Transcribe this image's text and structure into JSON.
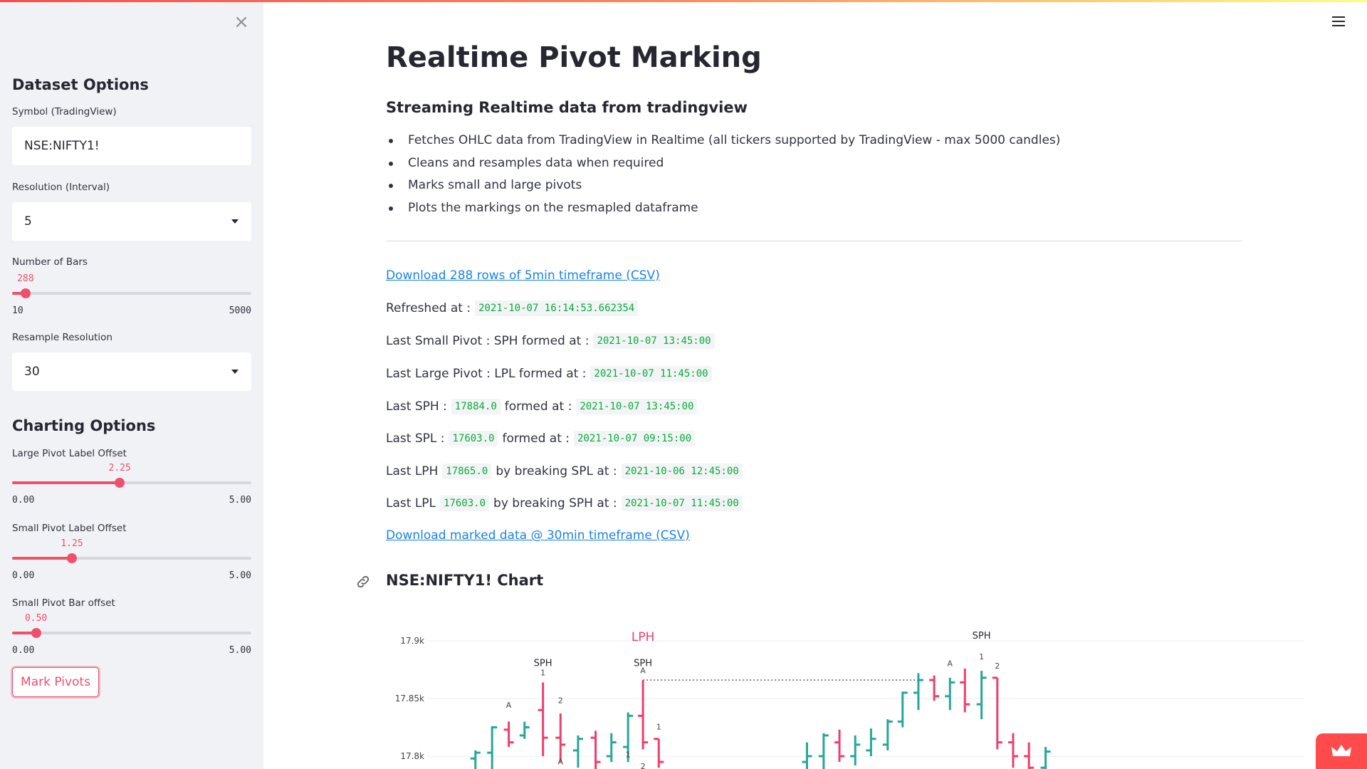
{
  "sidebar": {
    "dataset_heading": "Dataset Options",
    "symbol_label": "Symbol (TradingView)",
    "symbol_value": "NSE:NIFTY1!",
    "resolution_label": "Resolution (Interval)",
    "resolution_value": "5",
    "bars_label": "Number of Bars",
    "bars": {
      "value": "288",
      "min": "10",
      "max": "5000",
      "fraction": 0.056
    },
    "resample_label": "Resample Resolution",
    "resample_value": "30",
    "charting_heading": "Charting Options",
    "large_offset_label": "Large Pivot Label Offset",
    "large_offset": {
      "value": "2.25",
      "min": "0.00",
      "max": "5.00",
      "fraction": 0.45
    },
    "small_offset_label": "Small Pivot Label Offset",
    "small_offset": {
      "value": "1.25",
      "min": "0.00",
      "max": "5.00",
      "fraction": 0.25
    },
    "bar_offset_label": "Small Pivot Bar offset",
    "bar_offset": {
      "value": "0.50",
      "min": "0.00",
      "max": "5.00",
      "fraction": 0.1
    },
    "mark_button": "Mark Pivots"
  },
  "main": {
    "title": "Realtime Pivot Marking",
    "subtitle": "Streaming Realtime data from tradingview",
    "bullets": [
      "Fetches OHLC data from TradingView in Realtime (all tickers supported by TradingView - max 5000 candles)",
      "Cleans and resamples data when required",
      "Marks small and large pivots",
      "Plots the markings on the resmapled dataframe"
    ],
    "download_csv": "Download 288 rows of 5min timeframe (CSV)",
    "refreshed_label": "Refreshed at :",
    "refreshed_value": "2021-10-07 16:14:53.662354",
    "last_small_label": "Last Small Pivot : SPH formed at :",
    "last_small_value": "2021-10-07 13:45:00",
    "last_large_label": "Last Large Pivot : LPL formed at :",
    "last_large_value": "2021-10-07 11:45:00",
    "sph_label": "Last SPH :",
    "sph_value": "17884.0",
    "sph_mid": "formed at :",
    "sph_time": "2021-10-07 13:45:00",
    "spl_label": "Last SPL :",
    "spl_value": "17603.0",
    "spl_mid": "formed at :",
    "spl_time": "2021-10-07 09:15:00",
    "lph_label": "Last LPH",
    "lph_value": "17865.0",
    "lph_mid": "by breaking SPL at :",
    "lph_time": "2021-10-06 12:45:00",
    "lpl_label": "Last LPL",
    "lpl_value": "17603.0",
    "lpl_mid": "by breaking SPH at :",
    "lpl_time": "2021-10-07 11:45:00",
    "download_marked": "Download marked data @ 30min timeframe (CSV)",
    "chart_heading": "NSE:NIFTY1! Chart"
  },
  "colors": {
    "accent": "#f0506e",
    "up": "#26a69a",
    "down": "#ef3e6b",
    "code_green": "#09ab3b",
    "link": "#1c83e1"
  },
  "icons": {
    "close": "close-icon",
    "menu": "hamburger-icon",
    "link": "link-icon",
    "fab": "crown-icon"
  },
  "chart_data": {
    "type": "ohlc",
    "yticks": [
      "17.9k",
      "17.85k",
      "17.8k"
    ],
    "ytick_values": [
      17900,
      17850,
      17800
    ],
    "ylim": [
      17790,
      17910
    ],
    "bars": [
      {
        "i": 0,
        "o": 17798,
        "h": 17805,
        "l": 17782,
        "c": 17803
      },
      {
        "i": 1,
        "o": 17803,
        "h": 17826,
        "l": 17785,
        "c": 17825
      },
      {
        "i": 2,
        "o": 17823,
        "h": 17830,
        "l": 17808,
        "c": 17812
      },
      {
        "i": 3,
        "o": 17818,
        "h": 17830,
        "l": 17815,
        "c": 17825
      },
      {
        "i": 4,
        "o": 17840,
        "h": 17864,
        "l": 17800,
        "c": 17816
      },
      {
        "i": 5,
        "o": 17816,
        "h": 17837,
        "l": 17795,
        "c": 17810
      },
      {
        "i": 6,
        "o": 17805,
        "h": 17818,
        "l": 17790,
        "c": 17815
      },
      {
        "i": 7,
        "o": 17816,
        "h": 17822,
        "l": 17788,
        "c": 17795
      },
      {
        "i": 8,
        "o": 17800,
        "h": 17820,
        "l": 17795,
        "c": 17812
      },
      {
        "i": 9,
        "o": 17808,
        "h": 17838,
        "l": 17795,
        "c": 17835
      },
      {
        "i": 10,
        "o": 17835,
        "h": 17866,
        "l": 17806,
        "c": 17812
      },
      {
        "i": 11,
        "o": 17815,
        "h": 17812,
        "l": 17790,
        "c": 17795
      },
      {
        "i": 12,
        "o": 17795,
        "h": 17812,
        "l": 17785,
        "c": 17800
      },
      {
        "i": 13,
        "o": 17800,
        "h": 17820,
        "l": 17788,
        "c": 17818
      },
      {
        "i": 14,
        "o": 17812,
        "h": 17823,
        "l": 17795,
        "c": 17800
      },
      {
        "i": 15,
        "o": 17800,
        "h": 17818,
        "l": 17792,
        "c": 17810
      },
      {
        "i": 16,
        "o": 17805,
        "h": 17824,
        "l": 17800,
        "c": 17815
      },
      {
        "i": 17,
        "o": 17810,
        "h": 17832,
        "l": 17805,
        "c": 17830
      },
      {
        "i": 18,
        "o": 17830,
        "h": 17856,
        "l": 17825,
        "c": 17855
      },
      {
        "i": 19,
        "o": 17855,
        "h": 17872,
        "l": 17840,
        "c": 17866
      },
      {
        "i": 20,
        "o": 17866,
        "h": 17870,
        "l": 17848,
        "c": 17852
      },
      {
        "i": 21,
        "o": 17852,
        "h": 17868,
        "l": 17840,
        "c": 17864
      },
      {
        "i": 22,
        "o": 17864,
        "h": 17876,
        "l": 17838,
        "c": 17845
      },
      {
        "i": 23,
        "o": 17845,
        "h": 17874,
        "l": 17832,
        "c": 17868
      },
      {
        "i": 24,
        "o": 17868,
        "h": 17860,
        "l": 17806,
        "c": 17812
      },
      {
        "i": 25,
        "o": 17812,
        "h": 17820,
        "l": 17790,
        "c": 17800
      },
      {
        "i": 26,
        "o": 17800,
        "h": 17812,
        "l": 17785,
        "c": 17790
      },
      {
        "i": 27,
        "o": 17790,
        "h": 17808,
        "l": 17782,
        "c": 17804
      }
    ],
    "bar_x_pct": [
      5.5,
      7.4,
      9.3,
      11.1,
      13.2,
      15.2,
      17.2,
      19.2,
      21.0,
      22.9,
      24.6,
      26.4,
      43.3,
      45.2,
      47.0,
      48.8,
      50.6,
      52.5,
      54.2,
      56.0,
      57.8,
      59.6,
      61.3,
      63.2,
      65.0,
      66.8,
      68.6,
      70.5
    ],
    "annotations": [
      {
        "text": "LPH",
        "kind": "large",
        "bar": 10,
        "y": 17900
      },
      {
        "text": "SPH",
        "kind": "small",
        "bar": 4,
        "y": 17878
      },
      {
        "text": "SPH",
        "kind": "small",
        "bar": 10,
        "y": 17878
      },
      {
        "text": "SPH",
        "kind": "small",
        "bar": 23,
        "y": 17902
      },
      {
        "text": "A",
        "kind": "marker",
        "bar": 2,
        "y": 17842
      },
      {
        "text": "1",
        "kind": "marker",
        "bar": 4,
        "y": 17870
      },
      {
        "text": "2",
        "kind": "marker",
        "bar": 5,
        "y": 17846
      },
      {
        "text": "A",
        "kind": "marker",
        "bar": 5,
        "y": 17793
      },
      {
        "text": "A",
        "kind": "marker",
        "bar": 10,
        "y": 17872
      },
      {
        "text": "1",
        "kind": "marker",
        "bar": 9,
        "y": 17799
      },
      {
        "text": "1",
        "kind": "marker",
        "bar": 11,
        "y": 17823
      },
      {
        "text": "2",
        "kind": "marker",
        "bar": 10,
        "y": 17789
      },
      {
        "text": "A",
        "kind": "marker",
        "bar": 21,
        "y": 17878
      },
      {
        "text": "1",
        "kind": "marker",
        "bar": 23,
        "y": 17884
      },
      {
        "text": "2",
        "kind": "marker",
        "bar": 24,
        "y": 17876
      }
    ],
    "lph_line": {
      "y": 17866,
      "from_bar": 10,
      "to_bar": 19
    }
  }
}
